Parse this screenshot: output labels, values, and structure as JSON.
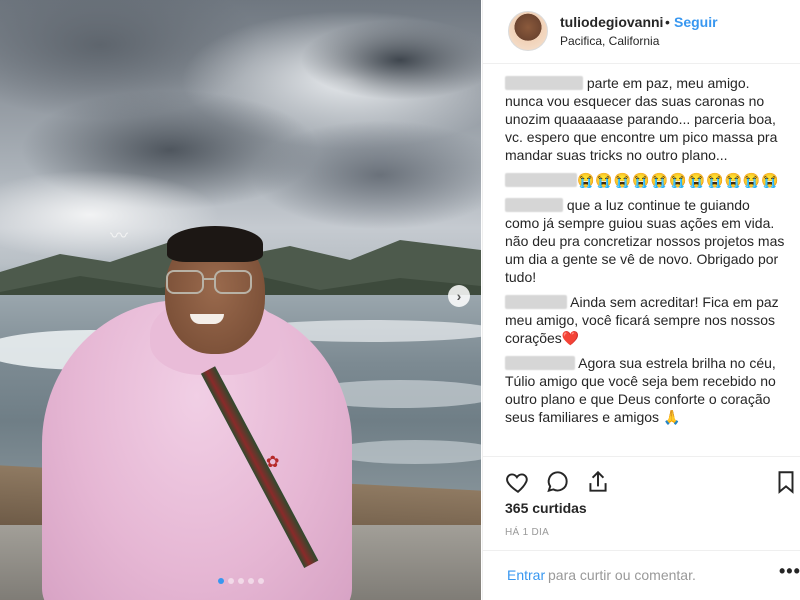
{
  "post": {
    "photo_icons": {
      "next": "chevron-right-icon",
      "bird": "seagull"
    },
    "carousel": {
      "count": 5,
      "active_index": 0
    }
  },
  "header": {
    "username": "tuliodegiovanni",
    "separator": "•",
    "follow_label": "Seguir",
    "location": "Pacifica, California"
  },
  "comments": [
    {
      "text_line1": " parte em paz, meu amigo.",
      "text_rest": "nunca vou esquecer das suas caronas no unozim quaaaaase parando... parceria boa, vc. espero que encontre um pico massa pra mandar suas tricks no outro plano..."
    },
    {
      "text": "😭😭😭😭😭😭😭😭😭😭😭"
    },
    {
      "text": " que a luz continue te guiando como já sempre guiou suas ações em vida. não deu pra concretizar nossos projetos mas um dia a gente se vê de novo. Obrigado por tudo!"
    },
    {
      "text": " Ainda sem acreditar! Fica em paz meu amigo, você ficará sempre nos nossos corações❤️"
    },
    {
      "text": " Agora sua estrela brilha no céu, Túlio amigo que você seja bem recebido no outro plano e que Deus conforte o coração seus familiares e amigos 🙏"
    }
  ],
  "actions": {
    "icons": [
      "heart-icon",
      "comment-icon",
      "share-icon",
      "bookmark-icon"
    ],
    "likes": "365 curtidas",
    "time": "HÁ 1 DIA"
  },
  "add_comment": {
    "login_label": "Entrar",
    "rest_label": "para curtir ou comentar.",
    "more_label": "•••"
  },
  "colors": {
    "accent": "#3897f0",
    "text": "#262626",
    "muted": "#999999",
    "border": "#efefef"
  }
}
